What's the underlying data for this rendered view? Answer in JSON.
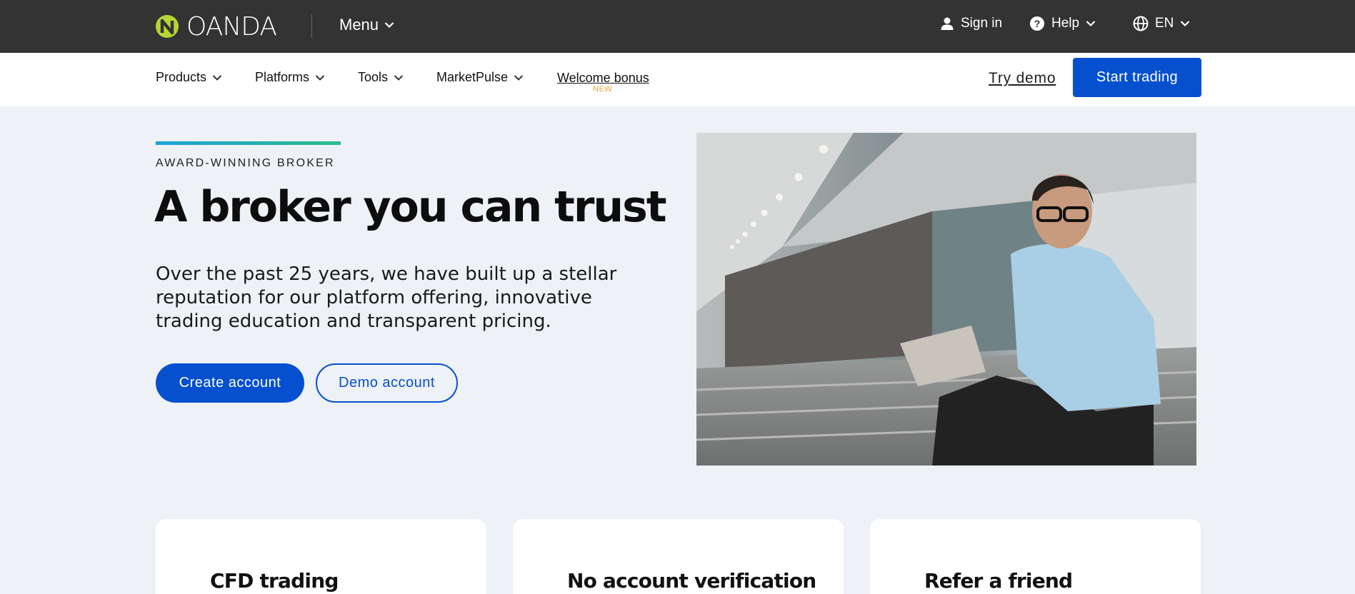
{
  "topbar": {
    "logo_text": "OANDA",
    "menu_label": "Menu",
    "sign_in": "Sign in",
    "help": "Help",
    "language": "EN"
  },
  "nav": {
    "items": [
      {
        "label": "Products"
      },
      {
        "label": "Platforms"
      },
      {
        "label": "Tools"
      },
      {
        "label": "MarketPulse"
      }
    ],
    "welcome_bonus": "Welcome bonus",
    "new_tag": "NEW",
    "try_demo": "Try demo",
    "start_trading": "Start trading"
  },
  "hero": {
    "eyebrow": "AWARD-WINNING BROKER",
    "title": "A broker you can trust",
    "description": "Over the past 25 years, we have built up a stellar reputation for our platform offering, innovative trading education and transparent pricing.",
    "create_account": "Create account",
    "demo_account": "Demo account"
  },
  "cards": [
    {
      "title": "CFD trading"
    },
    {
      "title": "No account verification"
    },
    {
      "title": "Refer a friend"
    }
  ],
  "colors": {
    "topbar_bg": "#333333",
    "brand_blue": "#0650d0",
    "logo_green": "#b6d433",
    "page_bg": "#eef1f5"
  },
  "icons": [
    "oanda-logo-icon",
    "chevron-down-icon",
    "user-icon",
    "help-icon",
    "globe-icon"
  ]
}
